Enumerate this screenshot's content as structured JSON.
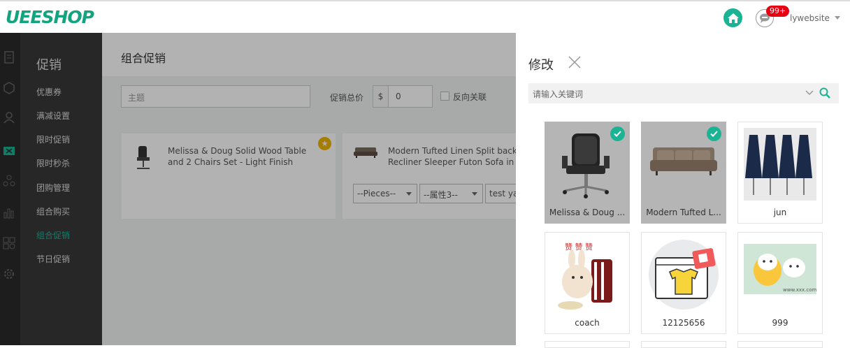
{
  "app": {
    "logo": "UEESHOP",
    "brand_color": "#14a37f",
    "accent": "#1ab394"
  },
  "header": {
    "notif_count": "99+",
    "username": "lywebsite"
  },
  "sidebar": {
    "title": "促销",
    "items": [
      {
        "label": "优惠券",
        "active": false
      },
      {
        "label": "满减设置",
        "active": false
      },
      {
        "label": "限时促销",
        "active": false
      },
      {
        "label": "限时秒杀",
        "active": false
      },
      {
        "label": "团购管理",
        "active": false
      },
      {
        "label": "组合购买",
        "active": false
      },
      {
        "label": "组合促销",
        "active": true
      },
      {
        "label": "节日促销",
        "active": false
      }
    ],
    "rail_icons": [
      "document-icon",
      "box-icon",
      "user-icon",
      "ticket-icon",
      "network-icon",
      "chart-icon",
      "grid-icon",
      "gear-icon"
    ]
  },
  "main": {
    "title": "组合促销",
    "subject_placeholder": "主题",
    "total_price_label": "促销总价",
    "currency": "$",
    "total_price_value": "0",
    "reverse_link_label": "反向关联",
    "cards": [
      {
        "name": "Melissa & Doug Solid Wood Table and 2 Chairs Set - Light Finish",
        "image": "chair-icon"
      },
      {
        "name": "Modern Tufted Linen Split back Recliner Sleeper Futon Sofa in",
        "image": "sofa-icon",
        "selects": [
          "--Pieces--",
          "--属性3--",
          "test ya"
        ]
      }
    ]
  },
  "panel": {
    "title": "修改",
    "search_placeholder": "请输入关键词",
    "products": [
      {
        "caption": "Melissa & Doug ...",
        "selected": true,
        "image": "office-chair-icon"
      },
      {
        "caption": "Modern Tufted L...",
        "selected": true,
        "image": "sofa-icon"
      },
      {
        "caption": "jun",
        "selected": false,
        "image": "dresses-icon"
      },
      {
        "caption": "coach",
        "selected": false,
        "image": "cartoon-rabbit-icon"
      },
      {
        "caption": "12125656",
        "selected": false,
        "image": "tshirt-shop-icon"
      },
      {
        "caption": "999",
        "selected": false,
        "image": "cartoon-cat-icon"
      }
    ]
  }
}
